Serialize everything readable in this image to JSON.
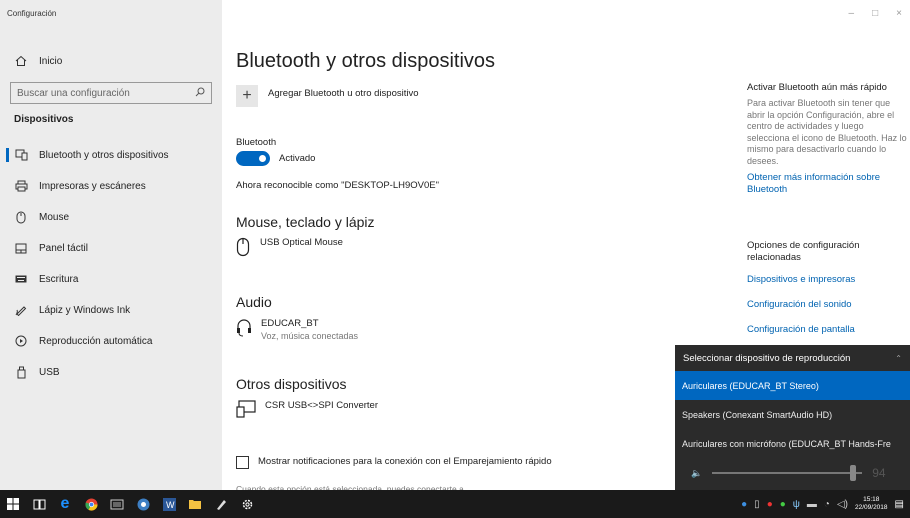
{
  "window": {
    "title": "Configuración",
    "controls": [
      "–",
      "□",
      "×"
    ]
  },
  "sidebar": {
    "home_label": "Inicio",
    "search_placeholder": "Buscar una configuración",
    "section_title": "Dispositivos",
    "items": [
      {
        "label": "Bluetooth y otros dispositivos",
        "icon": "bluetooth-device-icon",
        "active": true
      },
      {
        "label": "Impresoras y escáneres",
        "icon": "printer-icon",
        "active": false
      },
      {
        "label": "Mouse",
        "icon": "mouse-icon",
        "active": false
      },
      {
        "label": "Panel táctil",
        "icon": "touchpad-icon",
        "active": false
      },
      {
        "label": "Escritura",
        "icon": "keyboard-icon",
        "active": false
      },
      {
        "label": "Lápiz y Windows Ink",
        "icon": "pen-icon",
        "active": false
      },
      {
        "label": "Reproducción automática",
        "icon": "autoplay-icon",
        "active": false
      },
      {
        "label": "USB",
        "icon": "usb-icon",
        "active": false
      }
    ]
  },
  "main": {
    "page_title": "Bluetooth y otros dispositivos",
    "add_device_label": "Agregar Bluetooth u otro dispositivo",
    "bluetooth_label": "Bluetooth",
    "bluetooth_state": "Activado",
    "discoverable_text": "Ahora reconocible como \"DESKTOP-LH9OV0E\"",
    "mouse_section": {
      "title": "Mouse, teclado y lápiz",
      "devices": [
        {
          "name": "USB Optical Mouse",
          "status": ""
        }
      ]
    },
    "audio_section": {
      "title": "Audio",
      "devices": [
        {
          "name": "EDUCAR_BT",
          "status": "Voz, música conectadas"
        }
      ]
    },
    "other_section": {
      "title": "Otros dispositivos",
      "devices": [
        {
          "name": "CSR USB<>SPI Converter",
          "status": ""
        }
      ]
    },
    "swift_pair_label": "Mostrar notificaciones para la conexión con el Emparejamiento rápido",
    "swift_pair_desc": "Cuando esta opción está seleccionada, puedes conectarte a"
  },
  "right_panel": {
    "tip_title": "Activar Bluetooth aún más rápido",
    "tip_text": "Para activar Bluetooth sin tener que abrir la opción Configuración, abre el centro de actividades y luego selecciona el icono de Bluetooth. Haz lo mismo para desactivarlo cuando lo desees.",
    "tip_link": "Obtener más información sobre Bluetooth",
    "related_title": "Opciones de configuración relacionadas",
    "related_links": [
      "Dispositivos e impresoras",
      "Configuración del sonido",
      "Configuración de pantalla"
    ]
  },
  "playback_flyout": {
    "header": "Seleccionar dispositivo de reproducción",
    "devices": [
      {
        "label": "Auriculares (EDUCAR_BT Stereo)",
        "selected": true
      },
      {
        "label": "Speakers (Conexant SmartAudio HD)",
        "selected": false
      },
      {
        "label": "Auriculares con micrófono (EDUCAR_BT Hands-Fre",
        "selected": false
      }
    ],
    "volume": 94
  },
  "taskbar": {
    "time": "15:18",
    "date": "22/09/2018"
  },
  "colors": {
    "accent": "#0067c0",
    "link": "#0063b1",
    "sidebar_bg": "#ececec",
    "flyout_bg": "#2b2b2b",
    "taskbar_bg": "#1a1a1a"
  }
}
